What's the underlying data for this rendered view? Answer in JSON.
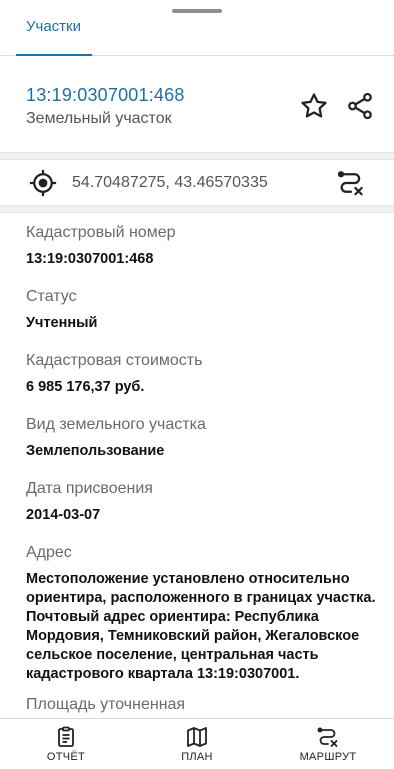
{
  "sheet": {
    "tab_label": "Участки"
  },
  "parcel": {
    "cadastral_number_title": "13:19:0307001:468",
    "type": "Земельный участок",
    "coordinates": "54.70487275, 43.46570335"
  },
  "fields": {
    "cadastral_number": {
      "label": "Кадастровый номер",
      "value": "13:19:0307001:468"
    },
    "status": {
      "label": "Статус",
      "value": "Учтенный"
    },
    "cadastral_value": {
      "label": "Кадастровая стоимость",
      "value": "6 985 176,37 руб."
    },
    "land_use": {
      "label": "Вид земельного участка",
      "value": "Землепользование"
    },
    "assigned_date": {
      "label": "Дата присвоения",
      "value": "2014-03-07"
    },
    "address": {
      "label": "Адрес",
      "value": "Местоположение установлено относительно ориентира, расположенного в границах участка. Почтовый адрес ориентира: Республика Мордовия, Темниковский район, Жегаловское сельское поселение, центральная часть кадастрового квартала 13:19:0307001."
    },
    "area": {
      "label": "Площадь уточненная"
    }
  },
  "bottom_nav": {
    "report": "ОТЧЁТ",
    "plan": "ПЛАН",
    "route": "МАРШРУТ"
  },
  "colors": {
    "accent": "#1e6fa8",
    "text": "#111111",
    "muted": "#6a6a6a"
  },
  "icons": {
    "favorite": "star-icon",
    "share": "share-icon",
    "location": "crosshair-icon",
    "route": "route-icon",
    "report": "clipboard-icon",
    "plan": "map-icon"
  }
}
